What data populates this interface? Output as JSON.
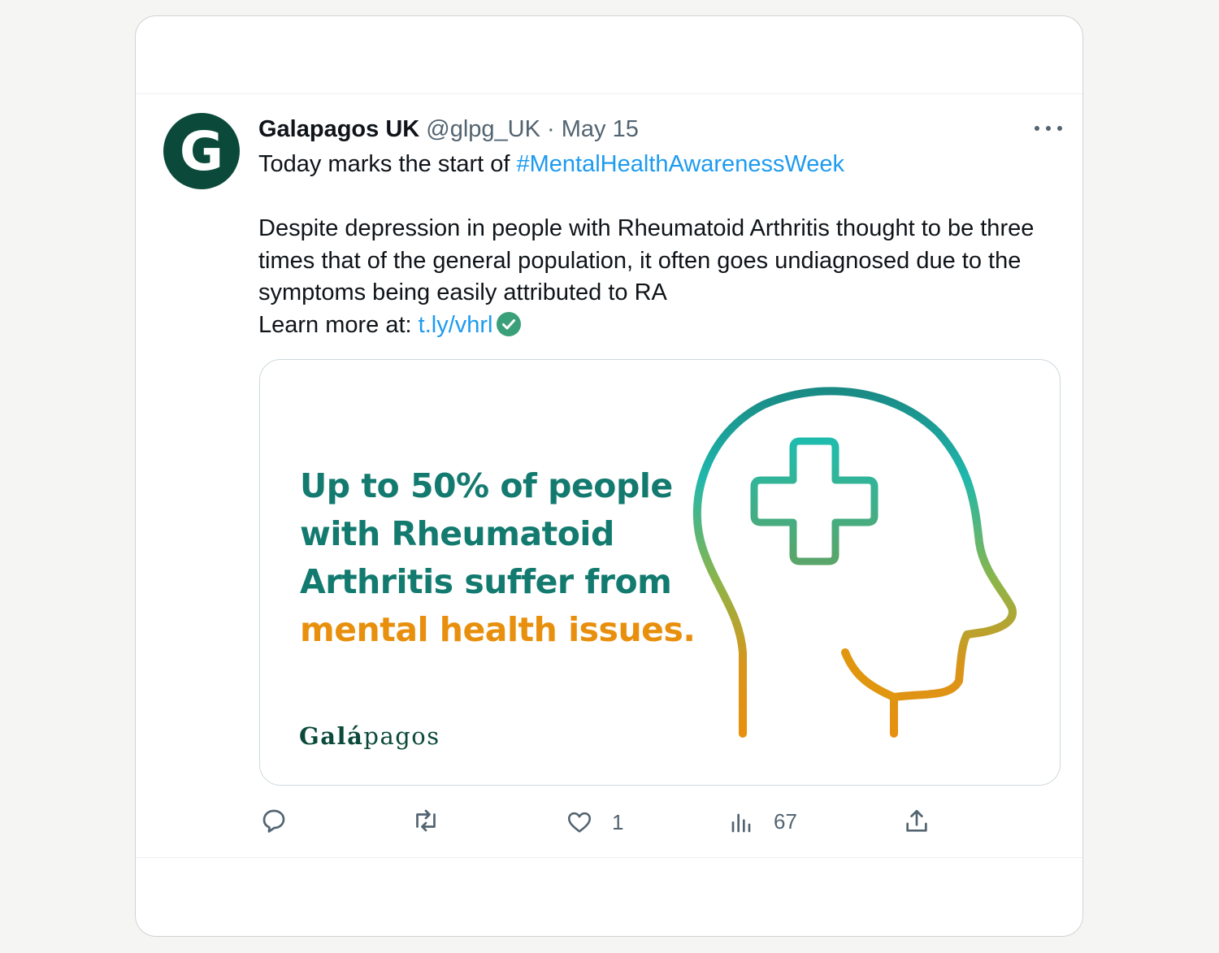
{
  "tweet": {
    "avatar_letter": "G",
    "display_name": "Galapagos UK",
    "handle": "@glpg_UK",
    "separator": "·",
    "date": "May 15",
    "line1_prefix": "Today marks the start of ",
    "hashtag": "#MentalHealthAwarenessWeek",
    "body": "Despite depression in people with Rheumatoid Arthritis thought to be three times that of the general population, it often goes undiagnosed due to the symptoms being easily attributed to RA",
    "learn_prefix": "Learn more at: ",
    "learn_link": "t.ly/vhrl"
  },
  "media": {
    "headline_lines": [
      "Up to 50% of people",
      "with Rheumatoid",
      "Arthritis suffer from"
    ],
    "headline_highlight": "mental health issues.",
    "brand": "Galápagos",
    "brand_bold": "Galá",
    "brand_rest": "pagos"
  },
  "actions": {
    "reply_count": "",
    "retweet_count": "",
    "like_count": "1",
    "views_count": "67"
  },
  "icons": {
    "reply": "reply-icon",
    "retweet": "retweet-icon",
    "like": "heart-icon",
    "views": "views-icon",
    "share": "share-icon",
    "verified": "verified-check-icon",
    "more": "more-options-icon"
  },
  "colors": {
    "link": "#1d9bf0",
    "teal": "#137a6f",
    "orange": "#e8900e",
    "avatar_bg": "#0b4a3a",
    "muted": "#536471"
  }
}
